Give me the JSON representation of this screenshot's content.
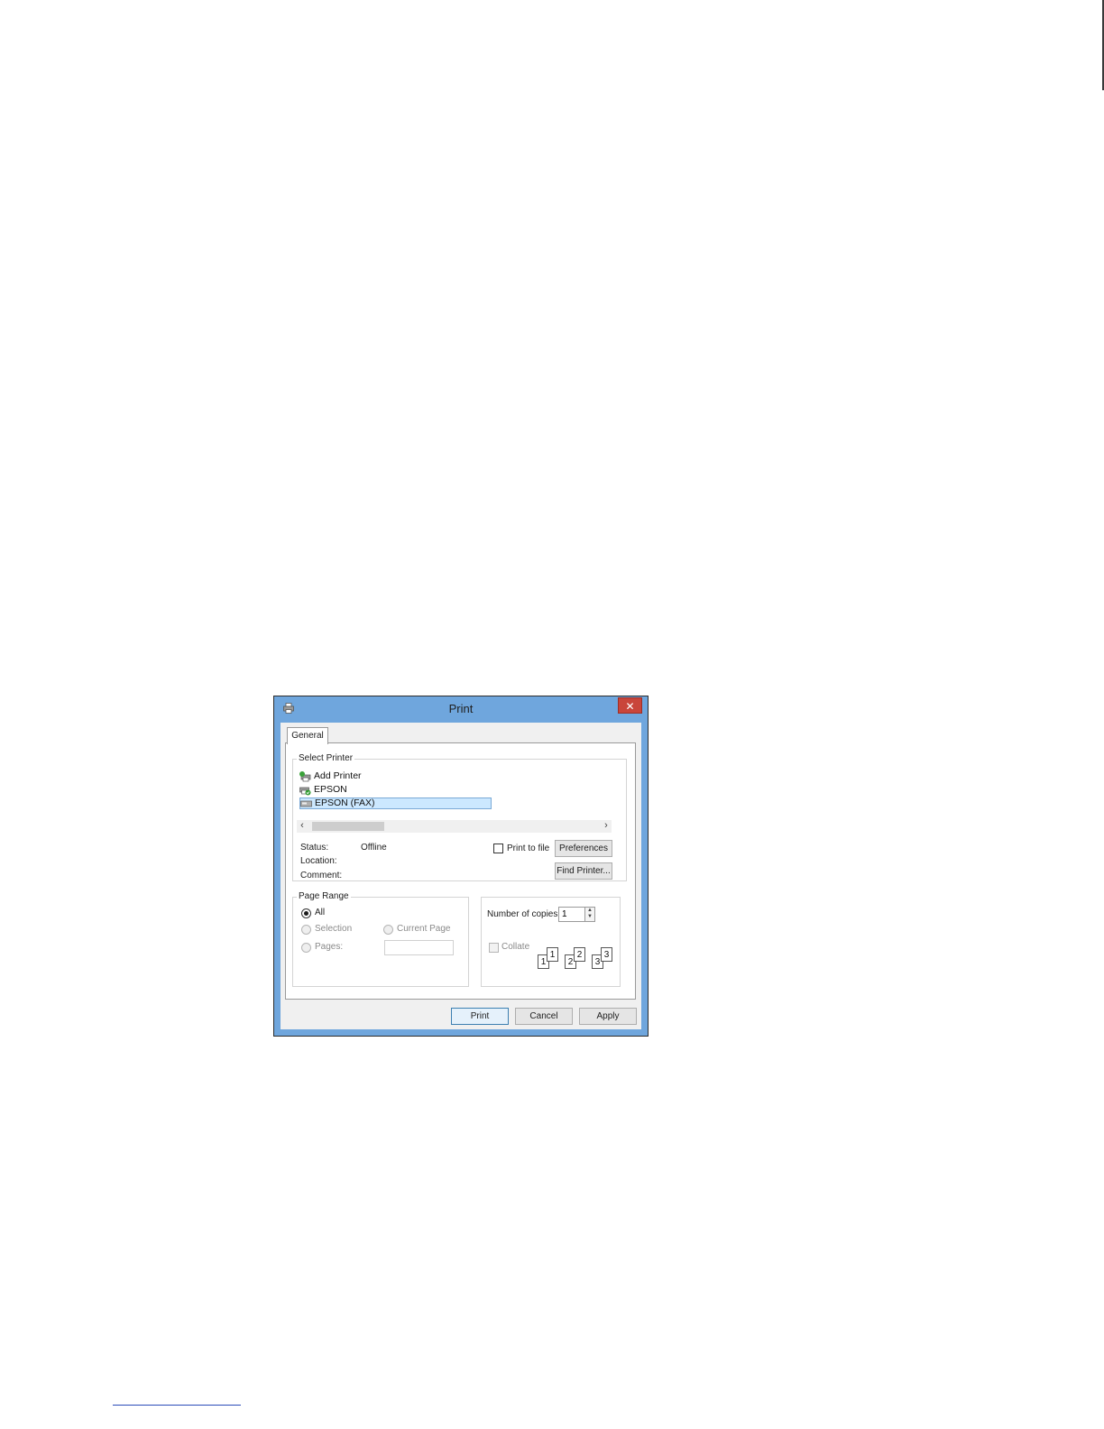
{
  "dialog": {
    "title": "Print",
    "close_label": "✕",
    "tabs": [
      {
        "label": "General"
      }
    ],
    "select_printer": {
      "legend": "Select Printer",
      "printers": [
        {
          "name": "Add Printer",
          "icon": "add-printer-icon"
        },
        {
          "name": "EPSON",
          "icon": "printer-default-icon"
        },
        {
          "name": "EPSON (FAX)",
          "icon": "fax-icon",
          "selected": true
        }
      ],
      "scroll_left": "‹",
      "scroll_right": "›",
      "status_label": "Status:",
      "status_value": "Offline",
      "location_label": "Location:",
      "comment_label": "Comment:",
      "print_to_file_label": "Print to file",
      "preferences_label": "Preferences",
      "find_printer_label": "Find Printer..."
    },
    "page_range": {
      "legend": "Page Range",
      "all_label": "All",
      "selection_label": "Selection",
      "current_page_label": "Current Page",
      "pages_label": "Pages:",
      "pages_value": ""
    },
    "copies": {
      "label": "Number of copies:",
      "value": "1",
      "collate_label": "Collate",
      "collate_pages": [
        "1",
        "1",
        "2",
        "2",
        "3",
        "3"
      ]
    },
    "buttons": {
      "print": "Print",
      "cancel": "Cancel",
      "apply": "Apply"
    }
  }
}
